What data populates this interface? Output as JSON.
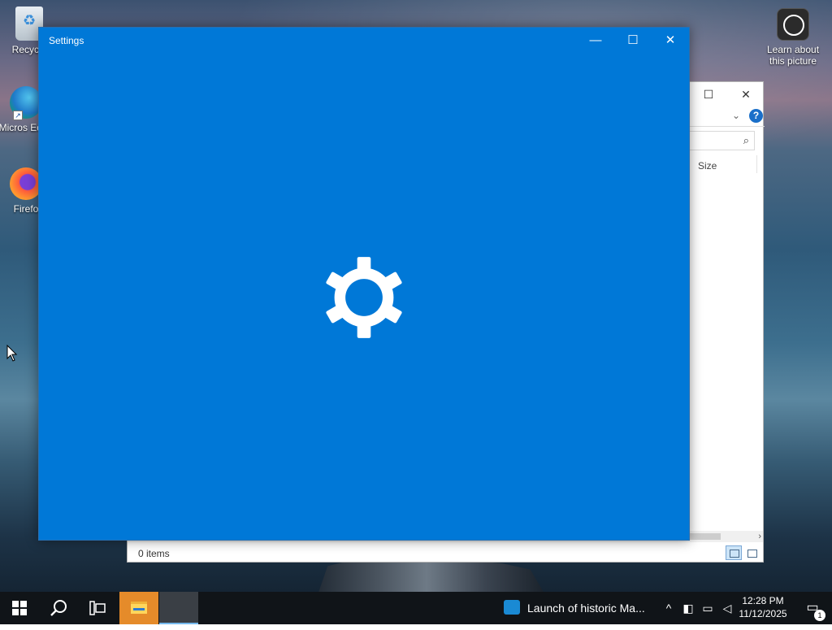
{
  "desktop": {
    "icons": [
      {
        "label": "Recycle",
        "icon": "recycle-bin-icon"
      },
      {
        "label": "Micros Edge",
        "icon": "edge-icon"
      },
      {
        "label": "Firefo",
        "icon": "firefox-icon"
      },
      {
        "label": "Learn about this picture",
        "icon": "learn-picture-icon"
      }
    ]
  },
  "explorer": {
    "column_size": "Size",
    "status_items": "0 items"
  },
  "settings": {
    "title": "Settings",
    "icon": "gear-icon",
    "accent_color": "#0078d7"
  },
  "taskbar": {
    "news_text": "Launch of historic Ma...",
    "clock_time": "12:28 PM",
    "clock_date": "11/12/2025",
    "notification_count": "1"
  }
}
